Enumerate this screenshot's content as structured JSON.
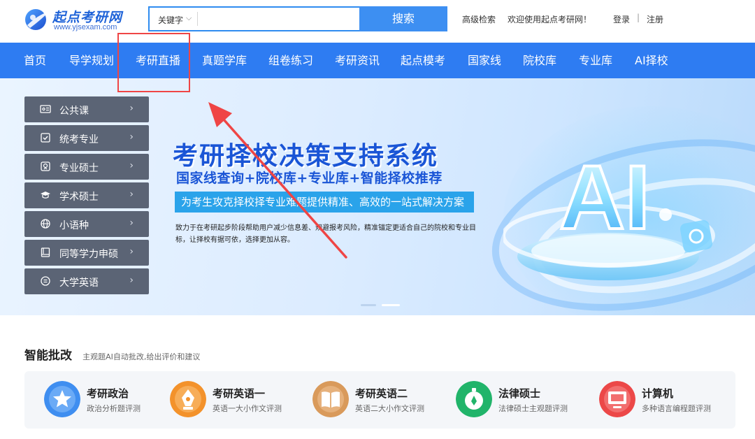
{
  "header": {
    "logo_name": "起点考研网",
    "logo_url": "www.yjsexam.com",
    "search": {
      "select_value": "关键字",
      "placeholder": "",
      "button_label": "搜索"
    },
    "links": {
      "advanced_search": "高级检索",
      "welcome": "欢迎使用起点考研网！",
      "login": "登录",
      "divider": "|",
      "register": "注册"
    }
  },
  "nav": {
    "items": [
      "首页",
      "导学规划",
      "考研直播",
      "真题学库",
      "组卷练习",
      "考研资讯",
      "起点模考",
      "国家线",
      "院校库",
      "专业库",
      "AI择校"
    ]
  },
  "sidebar": {
    "categories": [
      {
        "label": "公共课",
        "icon": "id-card-icon"
      },
      {
        "label": "统考专业",
        "icon": "check-square-icon"
      },
      {
        "label": "专业硕士",
        "icon": "badge-icon"
      },
      {
        "label": "学术硕士",
        "icon": "graduation-cap-icon"
      },
      {
        "label": "小语种",
        "icon": "globe-icon"
      },
      {
        "label": "同等学力申硕",
        "icon": "book-icon"
      },
      {
        "label": "大学英语",
        "icon": "chat-face-icon"
      }
    ]
  },
  "banner": {
    "title": "考研择校决策支持系统",
    "subtitle": "国家线查询+院校库+专业库+智能择校推荐",
    "strip": "为考生攻克择校择专业难题提供精准、高效的一站式解决方案",
    "description": "致力于在考研起步阶段帮助用户减少信息差、规避报考风险，精准锚定更适合自己的院校和专业目标，让择校有据可依，选择更加从容。",
    "art_text": "AI",
    "slide_count": 2,
    "active_slide": 2
  },
  "grading": {
    "title": "智能批改",
    "description": "主观题AI自动批改,给出评价和建议",
    "cards": [
      {
        "title": "考研政治",
        "desc": "政治分析题评测",
        "icon": "star-icon",
        "color": "#3f8ef0"
      },
      {
        "title": "考研英语一",
        "desc": "英语一大小作文评测",
        "icon": "pen-nib-icon",
        "color": "#f3922b"
      },
      {
        "title": "考研英语二",
        "desc": "英语二大小作文评测",
        "icon": "open-book-icon",
        "color": "#d99a5b"
      },
      {
        "title": "法律硕士",
        "desc": "法律硕士主观题评测",
        "icon": "stopwatch-icon",
        "color": "#21b46a"
      },
      {
        "title": "计算机",
        "desc": "多种语言编程题评测",
        "icon": "monitor-icon",
        "color": "#ec4848"
      }
    ]
  },
  "colors": {
    "brand": "#2e7cf2",
    "annotation": "#ef4545",
    "sidebar_item": "#5b6475"
  }
}
